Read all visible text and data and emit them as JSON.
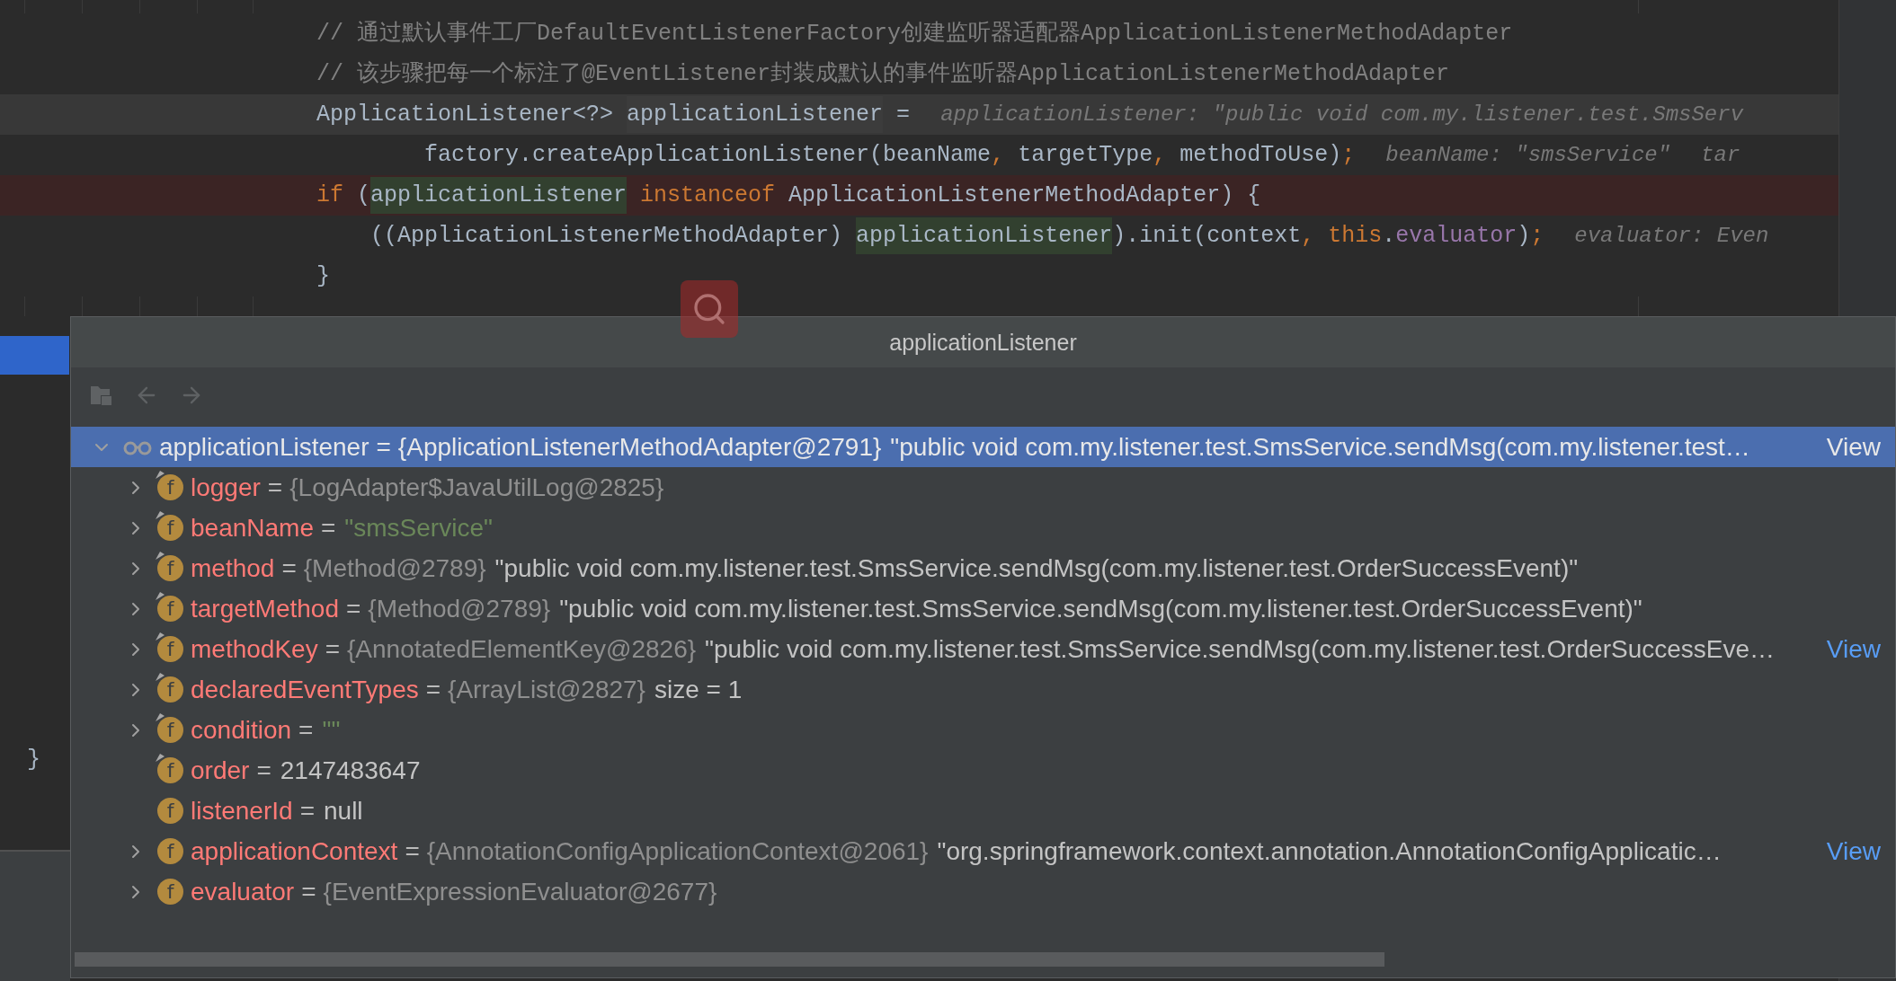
{
  "editor": {
    "code_lines": [
      {
        "tokens": [
          {
            "text": "// 通过默认事件工厂DefaultEventListenerFactory创建监听器适配器ApplicationListenerMethodAdapter",
            "kind": "comment"
          }
        ]
      },
      {
        "tokens": [
          {
            "text": "// 该步骤把每一个标注了@EventListener封装成默认的事件监听器ApplicationListenerMethodAdapter",
            "kind": "comment"
          }
        ]
      },
      {
        "current": true,
        "tokens": [
          {
            "text": "ApplicationListener<?> ",
            "kind": "plain"
          },
          {
            "text": "applicationListener",
            "kind": "caret_ref"
          },
          {
            "text": " =",
            "kind": "plain"
          }
        ],
        "hints": [
          "applicationListener: \"public void com.my.listener.test.SmsServ"
        ]
      },
      {
        "tokens": [
          {
            "text": "        factory.createApplicationListener(beanName",
            "kind": "plain"
          },
          {
            "text": ", ",
            "kind": "keyword"
          },
          {
            "text": "targetType",
            "kind": "plain"
          },
          {
            "text": ", ",
            "kind": "keyword"
          },
          {
            "text": "methodToUse)",
            "kind": "plain"
          },
          {
            "text": ";",
            "kind": "keyword"
          }
        ],
        "hints": [
          "beanName: \"smsService\"",
          "tar"
        ]
      },
      {
        "breakpoint": true,
        "tokens": [
          {
            "text": "if ",
            "kind": "keyword"
          },
          {
            "text": "(",
            "kind": "plain"
          },
          {
            "text": "applicationListener",
            "kind": "ref"
          },
          {
            "text": " instanceof ",
            "kind": "keyword"
          },
          {
            "text": "ApplicationListenerMethodAdapter) {",
            "kind": "plain"
          }
        ]
      },
      {
        "tokens": [
          {
            "text": "    ((ApplicationListenerMethodAdapter) ",
            "kind": "plain"
          },
          {
            "text": "applicationListener",
            "kind": "ref"
          },
          {
            "text": ").init(context",
            "kind": "plain"
          },
          {
            "text": ", ",
            "kind": "keyword"
          },
          {
            "text": "this",
            "kind": "keyword"
          },
          {
            "text": ".",
            "kind": "plain"
          },
          {
            "text": "evaluator",
            "kind": "field"
          },
          {
            "text": ")",
            "kind": "plain"
          },
          {
            "text": ";",
            "kind": "keyword"
          }
        ],
        "hints": [
          "evaluator: Even"
        ]
      },
      {
        "tokens": [
          {
            "text": "}",
            "kind": "plain"
          }
        ]
      }
    ],
    "side_brace": "}"
  },
  "popup": {
    "title": "applicationListener",
    "toolbar": [
      {
        "kind": "watch",
        "disabled": true
      },
      {
        "kind": "back",
        "disabled": true
      },
      {
        "kind": "forward",
        "disabled": true
      }
    ],
    "tree": [
      {
        "kind": "object",
        "name": "applicationListener",
        "op": "=",
        "type": "{ApplicationListenerMethodAdapter@2791}",
        "value": "\"public void com.my.listener.test.SmsService.sendMsg(com.my.listener.test…",
        "view": "View",
        "selected": true,
        "expanded": true,
        "children": [
          {
            "kind": "field",
            "badge": "f",
            "final": true,
            "expandable": true,
            "name": "logger",
            "op": "=",
            "type": "{LogAdapter$JavaUtilLog@2825}",
            "selected": false
          },
          {
            "kind": "field",
            "badge": "f",
            "final": true,
            "expandable": true,
            "name": "beanName",
            "op": "=",
            "value": "\"smsService\"",
            "literal": true,
            "selected": false
          },
          {
            "kind": "field",
            "badge": "f",
            "final": true,
            "expandable": true,
            "name": "method",
            "op": "=",
            "type": "{Method@2789}",
            "value": "\"public void com.my.listener.test.SmsService.sendMsg(com.my.listener.test.OrderSuccessEvent)\"",
            "selected": false
          },
          {
            "kind": "field",
            "badge": "f",
            "final": true,
            "expandable": true,
            "name": "targetMethod",
            "op": "=",
            "type": "{Method@2789}",
            "value": "\"public void com.my.listener.test.SmsService.sendMsg(com.my.listener.test.OrderSuccessEvent)\"",
            "selected": false
          },
          {
            "kind": "field",
            "badge": "f",
            "final": true,
            "expandable": true,
            "name": "methodKey",
            "op": "=",
            "type": "{AnnotatedElementKey@2826}",
            "value": "\"public void com.my.listener.test.SmsService.sendMsg(com.my.listener.test.OrderSuccessEve…",
            "view": "View",
            "selected": false
          },
          {
            "kind": "field",
            "badge": "f",
            "final": true,
            "expandable": true,
            "name": "declaredEventTypes",
            "op": "=",
            "type": "{ArrayList@2827}",
            "value": "size = 1",
            "selected": false
          },
          {
            "kind": "field",
            "badge": "f",
            "final": true,
            "expandable": true,
            "name": "condition",
            "op": "=",
            "value": "\"\"",
            "literal": true,
            "selected": false
          },
          {
            "kind": "field",
            "badge": "f",
            "final": true,
            "expandable": false,
            "name": "order",
            "op": "=",
            "value": "2147483647",
            "selected": false
          },
          {
            "kind": "field",
            "badge": "f",
            "final": false,
            "expandable": false,
            "name": "listenerId",
            "op": "=",
            "value": "null",
            "selected": false
          },
          {
            "kind": "field",
            "badge": "f",
            "final": false,
            "expandable": true,
            "name": "applicationContext",
            "op": "=",
            "type": "{AnnotationConfigApplicationContext@2061}",
            "value": "\"org.springframework.context.annotation.AnnotationConfigApplicatic…",
            "view": "View",
            "selected": false
          },
          {
            "kind": "field",
            "badge": "f",
            "final": false,
            "expandable": true,
            "name": "evaluator",
            "op": "=",
            "type": "{EventExpressionEvaluator@2677}",
            "selected": false
          }
        ]
      }
    ]
  }
}
